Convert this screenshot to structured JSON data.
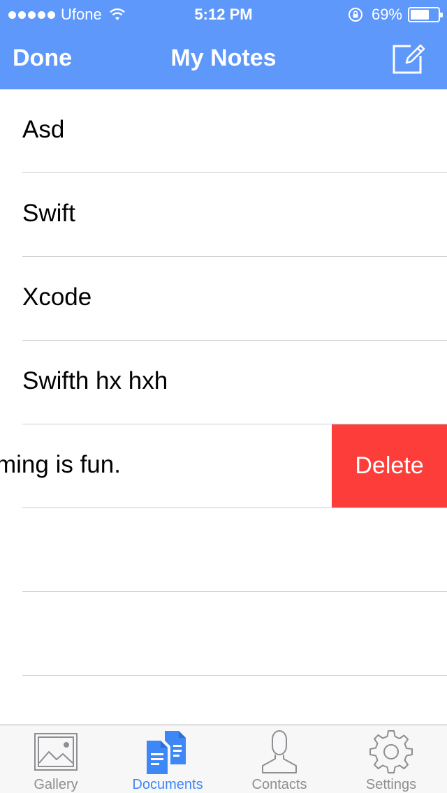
{
  "status_bar": {
    "carrier": "Ufone",
    "time": "5:12 PM",
    "battery_percent_label": "69%",
    "battery_level": 0.69
  },
  "nav": {
    "left_label": "Done",
    "title": "My Notes",
    "right_icon": "compose-icon"
  },
  "notes": [
    {
      "title": "Asd"
    },
    {
      "title": "Swift"
    },
    {
      "title": "Xcode"
    },
    {
      "title": "Swifth hx hxh"
    },
    {
      "title": "ming is fun.",
      "swiped": true
    }
  ],
  "row_actions": {
    "delete_label": "Delete"
  },
  "tabbar": {
    "tabs": [
      {
        "label": "Gallery",
        "icon": "gallery-icon",
        "active": false
      },
      {
        "label": "Documents",
        "icon": "documents-icon",
        "active": true
      },
      {
        "label": "Contacts",
        "icon": "contacts-icon",
        "active": false
      },
      {
        "label": "Settings",
        "icon": "settings-icon",
        "active": false
      }
    ]
  },
  "colors": {
    "nav_background": "#5e98fb",
    "delete_background": "#fc3d39",
    "active_tab": "#3e87f7",
    "inactive_tab": "#8e8e93"
  }
}
